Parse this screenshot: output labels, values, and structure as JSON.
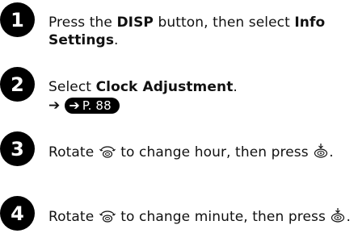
{
  "steps": [
    {
      "number": "1",
      "t1": "Press the ",
      "b1": "DISP",
      "t2": " button, then select ",
      "b2": "Info Settings",
      "t3": "."
    },
    {
      "number": "2",
      "t1": "Select ",
      "b1": "Clock Adjustment",
      "t2": ".",
      "arrow": "➔",
      "ref_arrow": "➔",
      "ref": "P. 88"
    },
    {
      "number": "3",
      "t1": "Rotate ",
      "t2": " to change hour, then press ",
      "t3": ".",
      "icons": [
        "rotary-dial-icon",
        "press-knob-icon"
      ]
    },
    {
      "number": "4",
      "t1": "Rotate ",
      "t2": " to change minute, then press ",
      "t3": ".",
      "icons": [
        "rotary-dial-icon",
        "press-knob-icon"
      ]
    }
  ]
}
